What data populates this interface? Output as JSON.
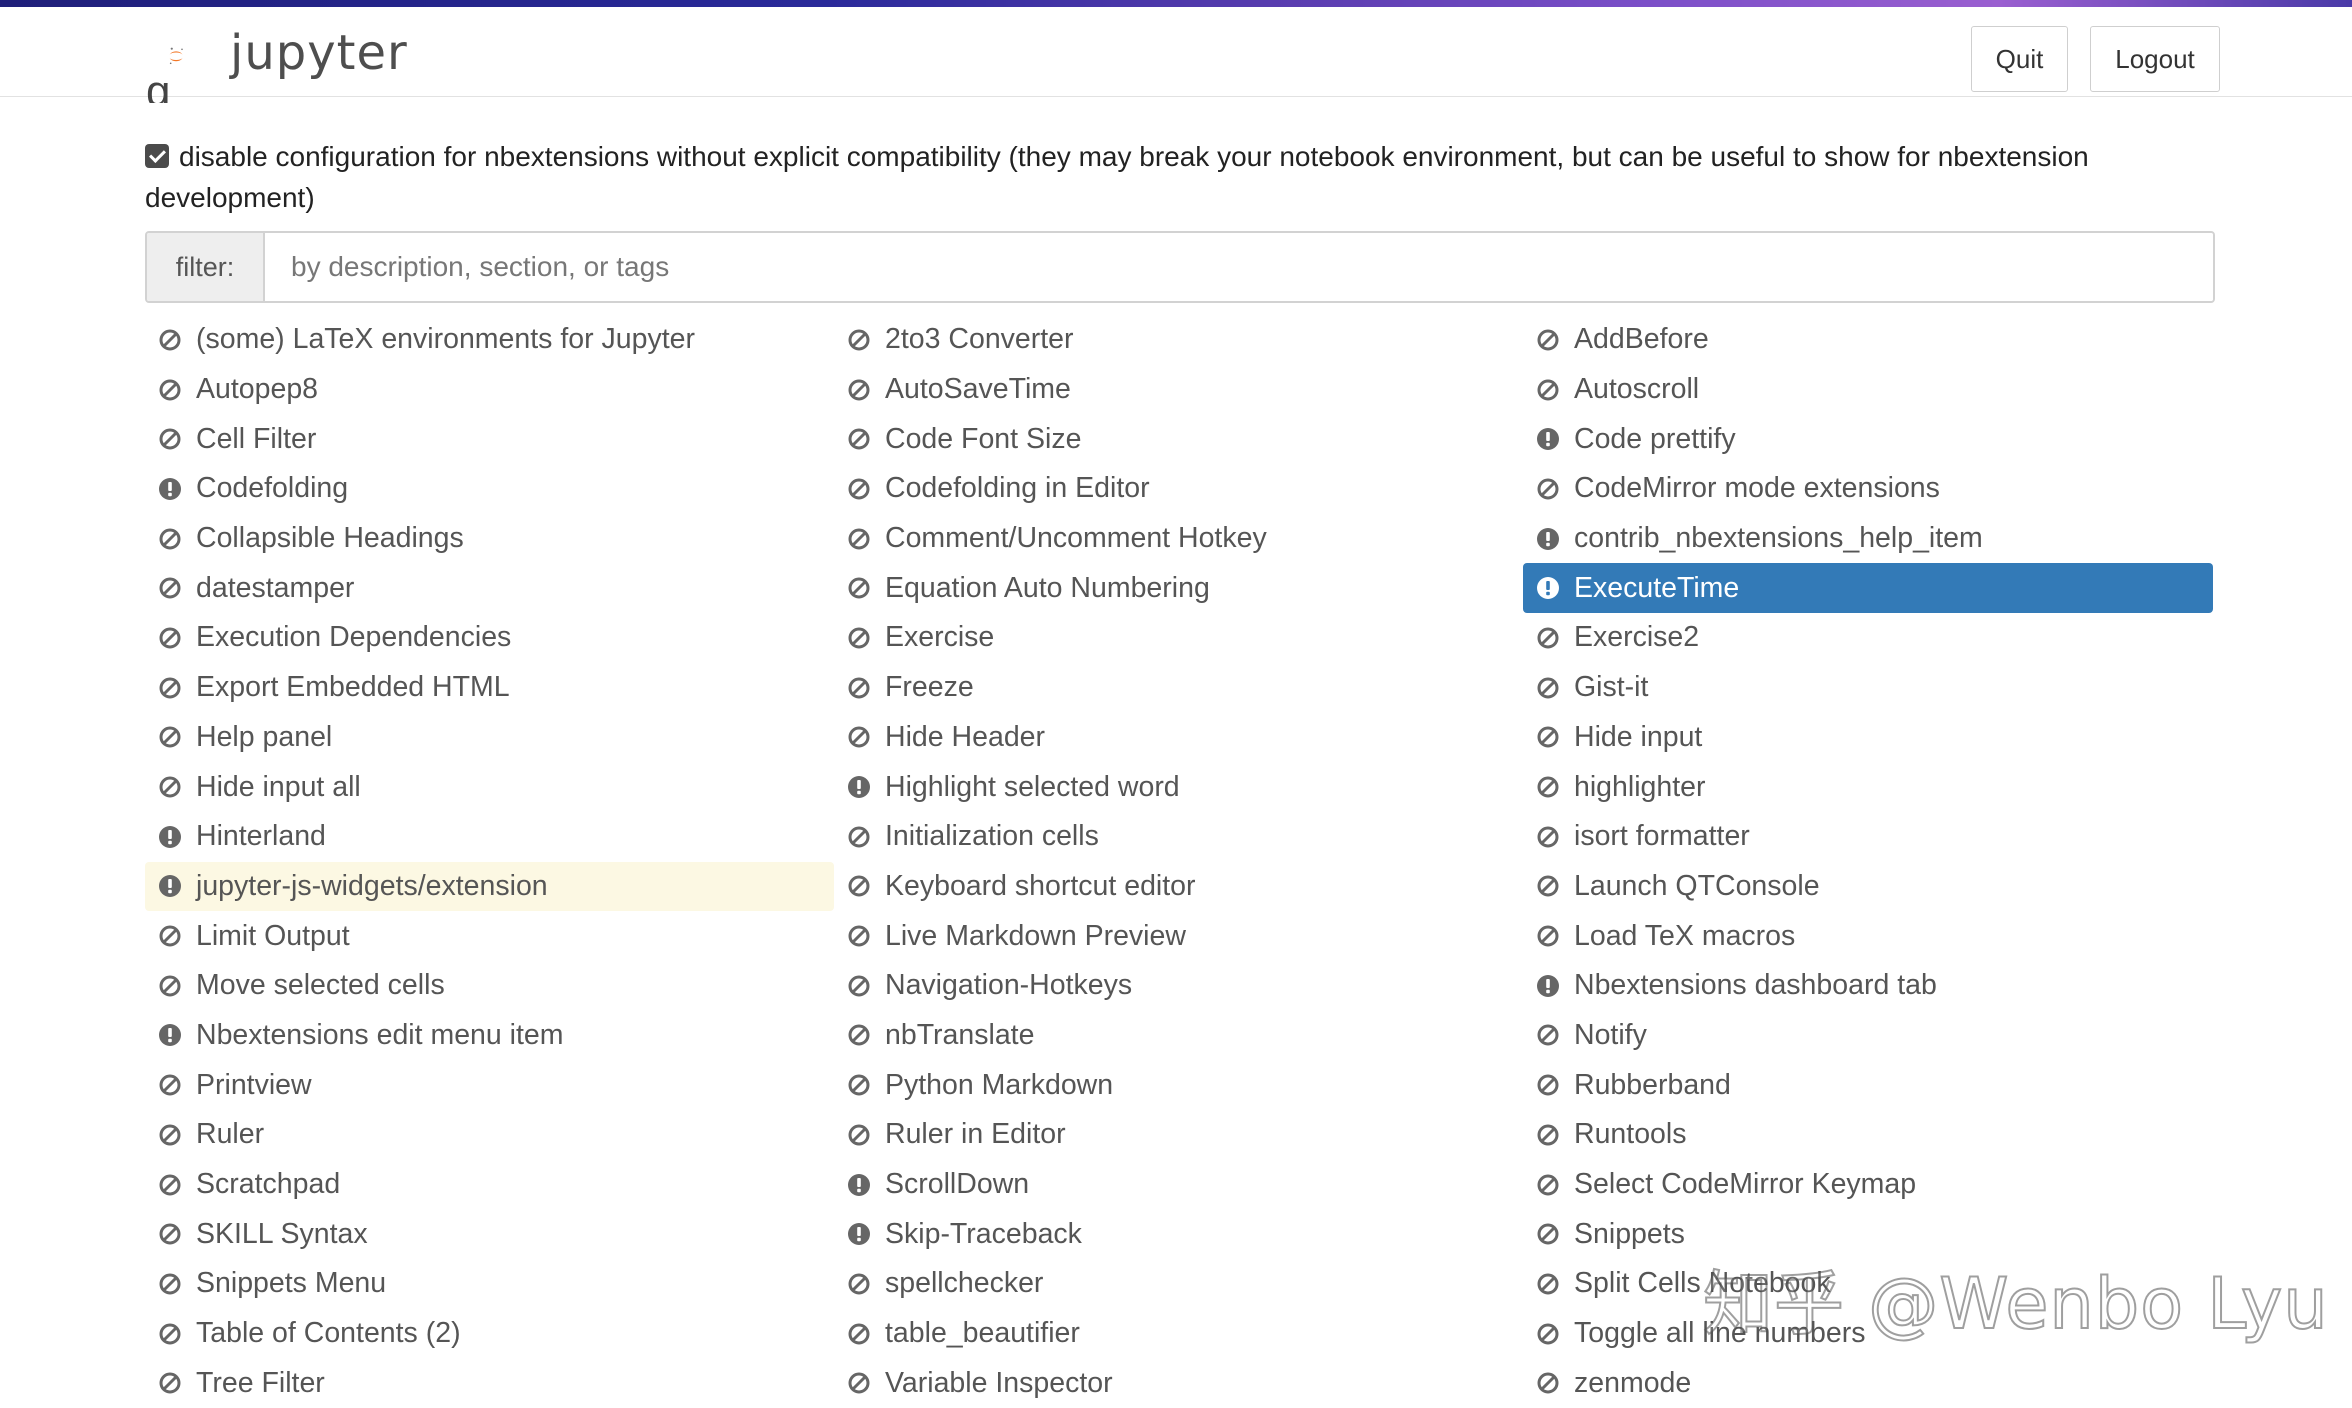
{
  "header": {
    "logo_text": "jupyter",
    "quit_label": "Quit",
    "logout_label": "Logout",
    "heading_fragment": "g"
  },
  "compat": {
    "checked": true,
    "text": "disable configuration for nbextensions without explicit compatibility (they may break your notebook environment, but can be useful to show for nbextension development)"
  },
  "filter": {
    "label": "filter:",
    "placeholder": "by description, section, or tags",
    "value": ""
  },
  "extensions": [
    {
      "label": "(some) LaTeX environments for Jupyter",
      "icon": "ban-icon",
      "state": "normal"
    },
    {
      "label": "2to3 Converter",
      "icon": "ban-icon",
      "state": "normal"
    },
    {
      "label": "AddBefore",
      "icon": "ban-icon",
      "state": "normal"
    },
    {
      "label": "Autopep8",
      "icon": "ban-icon",
      "state": "normal"
    },
    {
      "label": "AutoSaveTime",
      "icon": "ban-icon",
      "state": "normal"
    },
    {
      "label": "Autoscroll",
      "icon": "ban-icon",
      "state": "normal"
    },
    {
      "label": "Cell Filter",
      "icon": "ban-icon",
      "state": "normal"
    },
    {
      "label": "Code Font Size",
      "icon": "ban-icon",
      "state": "normal"
    },
    {
      "label": "Code prettify",
      "icon": "exclamation-icon",
      "state": "normal"
    },
    {
      "label": "Codefolding",
      "icon": "exclamation-icon",
      "state": "normal"
    },
    {
      "label": "Codefolding in Editor",
      "icon": "ban-icon",
      "state": "normal"
    },
    {
      "label": "CodeMirror mode extensions",
      "icon": "ban-icon",
      "state": "normal"
    },
    {
      "label": "Collapsible Headings",
      "icon": "ban-icon",
      "state": "normal"
    },
    {
      "label": "Comment/Uncomment Hotkey",
      "icon": "ban-icon",
      "state": "normal"
    },
    {
      "label": "contrib_nbextensions_help_item",
      "icon": "exclamation-icon",
      "state": "normal"
    },
    {
      "label": "datestamper",
      "icon": "ban-icon",
      "state": "normal"
    },
    {
      "label": "Equation Auto Numbering",
      "icon": "ban-icon",
      "state": "normal"
    },
    {
      "label": "ExecuteTime",
      "icon": "exclamation-icon",
      "state": "active"
    },
    {
      "label": "Execution Dependencies",
      "icon": "ban-icon",
      "state": "normal"
    },
    {
      "label": "Exercise",
      "icon": "ban-icon",
      "state": "normal"
    },
    {
      "label": "Exercise2",
      "icon": "ban-icon",
      "state": "normal"
    },
    {
      "label": "Export Embedded HTML",
      "icon": "ban-icon",
      "state": "normal"
    },
    {
      "label": "Freeze",
      "icon": "ban-icon",
      "state": "normal"
    },
    {
      "label": "Gist-it",
      "icon": "ban-icon",
      "state": "normal"
    },
    {
      "label": "Help panel",
      "icon": "ban-icon",
      "state": "normal"
    },
    {
      "label": "Hide Header",
      "icon": "ban-icon",
      "state": "normal"
    },
    {
      "label": "Hide input",
      "icon": "ban-icon",
      "state": "normal"
    },
    {
      "label": "Hide input all",
      "icon": "ban-icon",
      "state": "normal"
    },
    {
      "label": "Highlight selected word",
      "icon": "exclamation-icon",
      "state": "normal"
    },
    {
      "label": "highlighter",
      "icon": "ban-icon",
      "state": "normal"
    },
    {
      "label": "Hinterland",
      "icon": "exclamation-icon",
      "state": "normal"
    },
    {
      "label": "Initialization cells",
      "icon": "ban-icon",
      "state": "normal"
    },
    {
      "label": "isort formatter",
      "icon": "ban-icon",
      "state": "normal"
    },
    {
      "label": "jupyter-js-widgets/extension",
      "icon": "exclamation-icon",
      "state": "warning"
    },
    {
      "label": "Keyboard shortcut editor",
      "icon": "ban-icon",
      "state": "normal"
    },
    {
      "label": "Launch QTConsole",
      "icon": "ban-icon",
      "state": "normal"
    },
    {
      "label": "Limit Output",
      "icon": "ban-icon",
      "state": "normal"
    },
    {
      "label": "Live Markdown Preview",
      "icon": "ban-icon",
      "state": "normal"
    },
    {
      "label": "Load TeX macros",
      "icon": "ban-icon",
      "state": "normal"
    },
    {
      "label": "Move selected cells",
      "icon": "ban-icon",
      "state": "normal"
    },
    {
      "label": "Navigation-Hotkeys",
      "icon": "ban-icon",
      "state": "normal"
    },
    {
      "label": "Nbextensions dashboard tab",
      "icon": "exclamation-icon",
      "state": "normal"
    },
    {
      "label": "Nbextensions edit menu item",
      "icon": "exclamation-icon",
      "state": "normal"
    },
    {
      "label": "nbTranslate",
      "icon": "ban-icon",
      "state": "normal"
    },
    {
      "label": "Notify",
      "icon": "ban-icon",
      "state": "normal"
    },
    {
      "label": "Printview",
      "icon": "ban-icon",
      "state": "normal"
    },
    {
      "label": "Python Markdown",
      "icon": "ban-icon",
      "state": "normal"
    },
    {
      "label": "Rubberband",
      "icon": "ban-icon",
      "state": "normal"
    },
    {
      "label": "Ruler",
      "icon": "ban-icon",
      "state": "normal"
    },
    {
      "label": "Ruler in Editor",
      "icon": "ban-icon",
      "state": "normal"
    },
    {
      "label": "Runtools",
      "icon": "ban-icon",
      "state": "normal"
    },
    {
      "label": "Scratchpad",
      "icon": "ban-icon",
      "state": "normal"
    },
    {
      "label": "ScrollDown",
      "icon": "exclamation-icon",
      "state": "normal"
    },
    {
      "label": "Select CodeMirror Keymap",
      "icon": "ban-icon",
      "state": "normal"
    },
    {
      "label": "SKILL Syntax",
      "icon": "ban-icon",
      "state": "normal"
    },
    {
      "label": "Skip-Traceback",
      "icon": "exclamation-icon",
      "state": "normal"
    },
    {
      "label": "Snippets",
      "icon": "ban-icon",
      "state": "normal"
    },
    {
      "label": "Snippets Menu",
      "icon": "ban-icon",
      "state": "normal"
    },
    {
      "label": "spellchecker",
      "icon": "ban-icon",
      "state": "normal"
    },
    {
      "label": "Split Cells Notebook",
      "icon": "ban-icon",
      "state": "normal"
    },
    {
      "label": "Table of Contents (2)",
      "icon": "ban-icon",
      "state": "normal"
    },
    {
      "label": "table_beautifier",
      "icon": "ban-icon",
      "state": "normal"
    },
    {
      "label": "Toggle all line numbers",
      "icon": "ban-icon",
      "state": "normal"
    },
    {
      "label": "Tree Filter",
      "icon": "ban-icon",
      "state": "normal"
    },
    {
      "label": "Variable Inspector",
      "icon": "ban-icon",
      "state": "normal"
    },
    {
      "label": "zenmode",
      "icon": "ban-icon",
      "state": "normal"
    }
  ],
  "watermark": "知乎 @Wenbo Lyu",
  "colors": {
    "active_bg": "#337ab7",
    "warning_bg": "#fcf8e3",
    "icon": "#666666",
    "jupyter_orange": "#f37726"
  }
}
